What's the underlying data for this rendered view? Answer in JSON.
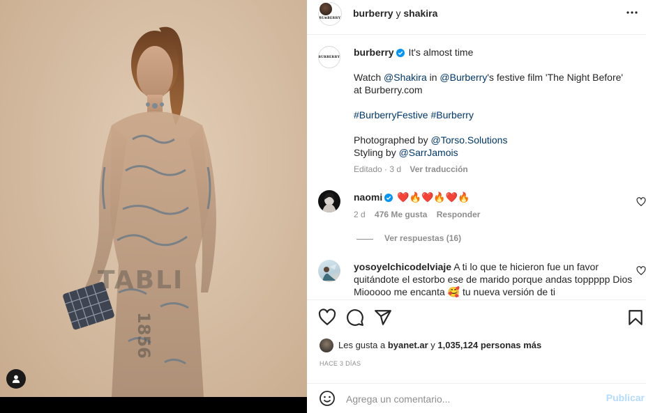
{
  "photo": {
    "text_print": "TABLI",
    "text_year": "1856"
  },
  "header": {
    "account": "burberry",
    "connector": " y ",
    "collaborator": "shakira",
    "avatar_brand": "BURBERRY",
    "more_icon": "more-horizontal-icon"
  },
  "caption": {
    "avatar_brand": "BURBERRY",
    "username": "burberry",
    "headline": "It's almost time",
    "line2_pre": "Watch ",
    "mention1": "@Shakira",
    "line2_mid": " in ",
    "mention2": "@Burberry",
    "line2_post": "'s festive film 'The Night Before' at Burberry.com",
    "hashtag1": "#BurberryFestive",
    "hashtag2": "#Burberry",
    "photo_pre": "Photographed by ",
    "photo_mention": "@Torso.Solutions",
    "styling_pre": "Styling by ",
    "styling_mention": "@SarrJamois",
    "edited": "Editado · 3 d",
    "translate": "Ver traducción"
  },
  "comments": [
    {
      "username": "naomi",
      "emojis": "❤️🔥❤️🔥❤️🔥",
      "time": "2 d",
      "likes": "476 Me gusta",
      "reply": "Responder",
      "view_replies": "Ver respuestas (16)"
    },
    {
      "username": "yosoyelchicodelviaje",
      "text": "A ti lo que te hicieron fue un favor quitándote el estorbo ese de marido porque andas toppppp Dios Miooooo me encanta 🥰 tu nueva versión de ti"
    }
  ],
  "actions": {
    "like_icon": "heart-icon",
    "comment_icon": "comment-icon",
    "share_icon": "send-icon",
    "save_icon": "bookmark-icon",
    "likes_pre": "Les gusta a ",
    "likes_user": "byanet.ar",
    "likes_mid": " y ",
    "likes_count": "1,035,124 personas más",
    "date": "HACE 3 DÍAS"
  },
  "composer": {
    "placeholder": "Agrega un comentario...",
    "post_label": "Publicar"
  },
  "colors": {
    "link": "#00376b",
    "verified": "#0095f6",
    "muted": "#8e8e8e",
    "post_disabled": "#b3dbff"
  }
}
